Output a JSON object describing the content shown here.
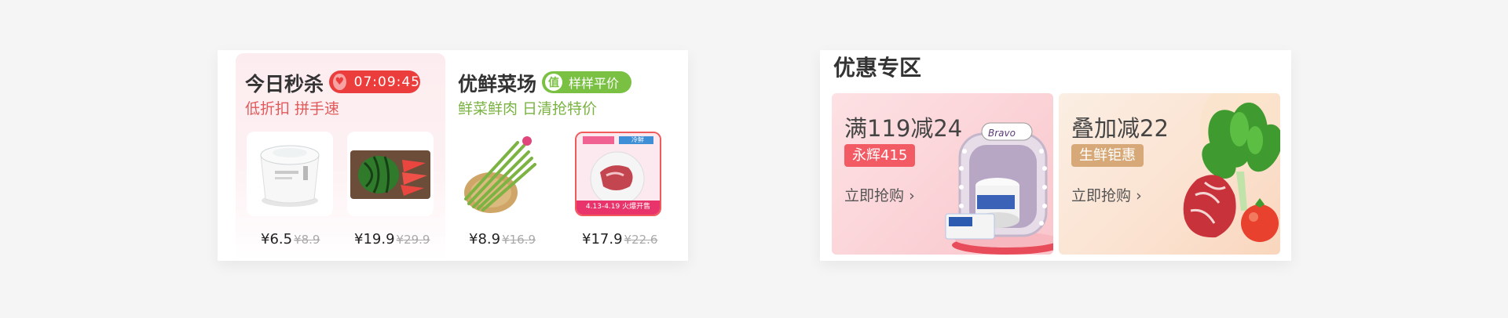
{
  "flash_sale": {
    "title": "今日秒杀",
    "countdown": "07:09:45",
    "subtitle": "低折扣 拼手速",
    "accent": "#ec3d3d"
  },
  "fresh_market": {
    "title": "优鲜菜场",
    "badge_icon_text": "值",
    "badge_label": "样样平价",
    "subtitle": "鲜菜鲜肉 日清抢特价",
    "accent": "#7ac143"
  },
  "products": [
    {
      "name": "yogurt-tub",
      "price": "¥6.5",
      "original_price": "¥8.9"
    },
    {
      "name": "watermelon",
      "price": "¥19.9",
      "original_price": "¥29.9"
    },
    {
      "name": "asparagus",
      "price": "¥8.9",
      "original_price": "¥16.9"
    },
    {
      "name": "steak",
      "price": "¥17.9",
      "original_price": "¥22.6",
      "label": "4.13-4.19 火爆开售",
      "top_tag": "冷鲜"
    }
  ],
  "deals": {
    "title": "优惠专区",
    "cards": [
      {
        "title": "满119减24",
        "tag": "永辉415",
        "tag_color": "#f25b64",
        "cta": "立即抢购",
        "brand": "Bravo"
      },
      {
        "title": "叠加减22",
        "tag": "生鲜钜惠",
        "tag_color": "#d8a978",
        "cta": "立即抢购"
      }
    ]
  }
}
